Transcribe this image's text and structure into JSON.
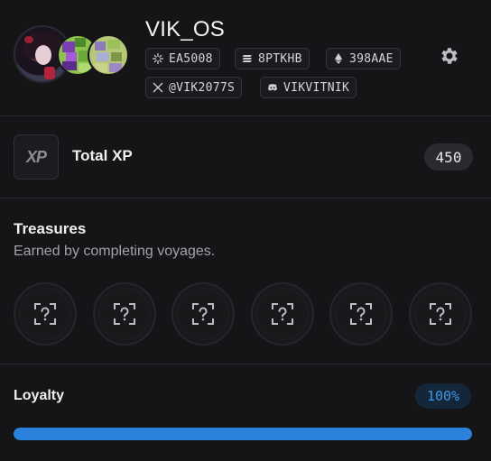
{
  "profile": {
    "name": "VIK_OS",
    "ids": [
      {
        "icon": "sparkle-icon",
        "label": "EA5008"
      },
      {
        "icon": "solana-icon",
        "label": "8PTKHB"
      },
      {
        "icon": "ethereum-icon",
        "label": "398AAE"
      }
    ],
    "socials": [
      {
        "icon": "x-icon",
        "label": "@VIK2077S"
      },
      {
        "icon": "discord-icon",
        "label": "VIKVITNIK"
      }
    ]
  },
  "xp": {
    "logo_text": "XP",
    "label": "Total XP",
    "value": "450"
  },
  "treasures": {
    "title": "Treasures",
    "subtitle": "Earned by completing voyages.",
    "slots": 6,
    "slot_icon": "unknown-question-icon"
  },
  "loyalty": {
    "title": "Loyalty",
    "percent_label": "100%",
    "progress": 1.0,
    "bar_color": "#2a82dc"
  },
  "colors": {
    "background": "#151517",
    "accent": "#2a82dc"
  }
}
